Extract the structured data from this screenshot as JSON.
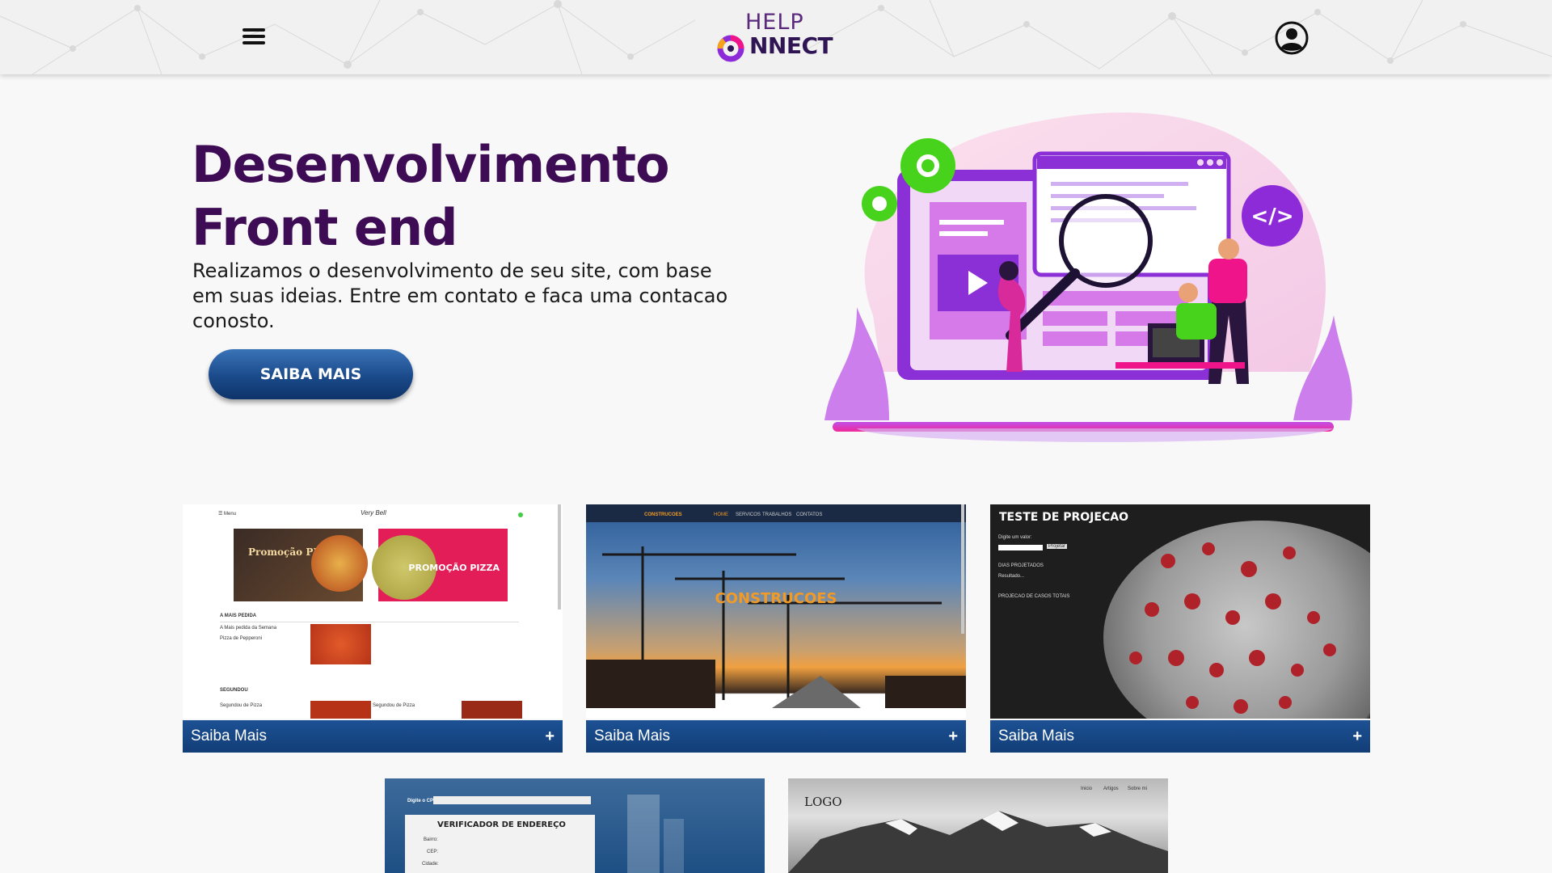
{
  "header": {
    "logo_top": "HELP",
    "logo_bottom": "NNECT",
    "menu_icon": "hamburger-menu-icon",
    "user_icon": "user-account-icon"
  },
  "hero": {
    "title_line1": "Desenvolvimento",
    "title_line2": "Front end",
    "description": "Realizamos o desenvolvimento de seu site, com base em suas ideias. Entre em contato e faca uma contacao conosto.",
    "cta_label": "SAIBA MAIS"
  },
  "colors": {
    "title": "#3e0c55",
    "button_blue": "#1b4a8a",
    "card_bar": "#1c5194",
    "accent_green": "#47d31b",
    "accent_purple": "#8e2bd8",
    "accent_pink": "#f0148a"
  },
  "cards": [
    {
      "label": "Saiba Mais",
      "plus": "+",
      "preview": {
        "menu": "☰ Menu",
        "brand": "Very Bell",
        "promo1": "Promoção PIZZA",
        "promo2": "PROMOÇÃO PIZZA",
        "section1": "A MAIS PEDIDA",
        "item1_title": "A Mais pedida da Semana",
        "item1_desc": "Pizza de Pepperoni",
        "section2": "SEGUNDOU",
        "item2_title": "Segundou de Pizza",
        "item3_title": "Segundou de Pizza"
      }
    },
    {
      "label": "Saiba Mais",
      "plus": "+",
      "preview": {
        "brand": "CONSTRUCOES",
        "nav": [
          "HOME",
          "SERVICOS",
          "TRABALHOS",
          "CONTATOS"
        ],
        "title": "CONSTRUCOES"
      }
    },
    {
      "label": "Saiba Mais",
      "plus": "+",
      "preview": {
        "title": "TESTE DE PROJECAO",
        "input_label": "Digite um valor:",
        "button": "Projetar",
        "line1": "DIAS PROJETADOS",
        "line2": "Resultado...",
        "line3": "PROJECAO DE CASOS TOTAIS"
      }
    },
    {
      "label": "",
      "preview": {
        "input_label": "Digite o CPF:",
        "title": "VERIFICADOR DE ENDEREÇO",
        "f1": "Bairro:",
        "f2": "CEP:",
        "f3": "Cidade:"
      }
    },
    {
      "label": "",
      "preview": {
        "logo": "LOGO",
        "nav": [
          "Inicio",
          "Artigos",
          "Sobre mi"
        ]
      }
    }
  ]
}
